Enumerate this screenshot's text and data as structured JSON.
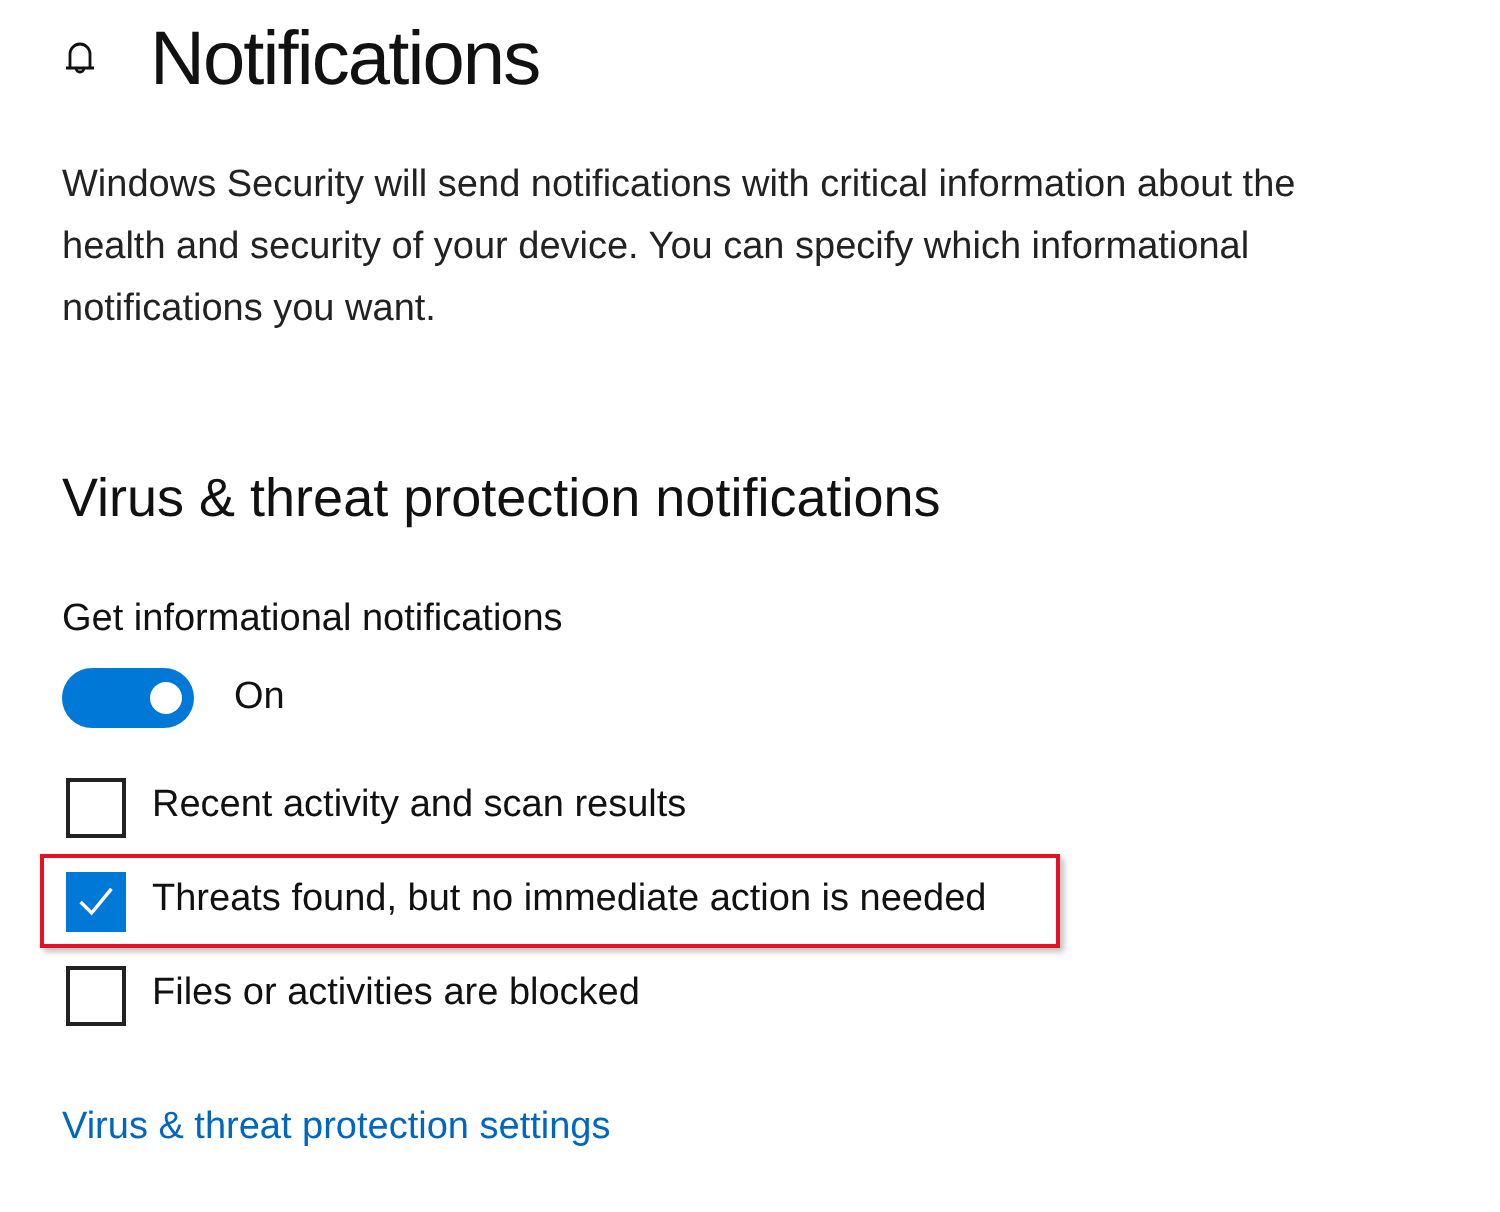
{
  "header": {
    "title": "Notifications"
  },
  "description": "Windows Security will send notifications with critical information about the health and security of your device. You can specify which informational notifications you want.",
  "section": {
    "title": "Virus & threat protection notifications",
    "toggle": {
      "label": "Get informational notifications",
      "on": true,
      "state_text": "On"
    },
    "options": [
      {
        "label": "Recent activity and scan results",
        "checked": false,
        "highlighted": false
      },
      {
        "label": "Threats found, but no immediate action is needed",
        "checked": true,
        "highlighted": true
      },
      {
        "label": "Files or activities are blocked",
        "checked": false,
        "highlighted": false
      }
    ],
    "link": "Virus & threat protection settings"
  }
}
